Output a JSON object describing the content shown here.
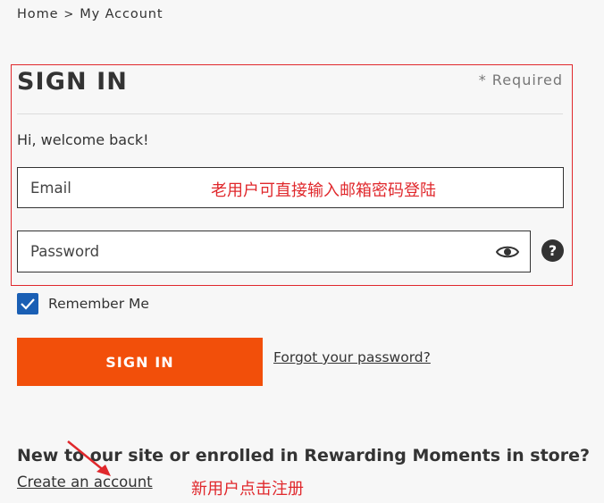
{
  "breadcrumb": {
    "home": "Home",
    "separator": ">",
    "current": "My Account"
  },
  "signin": {
    "title": "SIGN IN",
    "required_note": "* Required",
    "welcome": "Hi, welcome back!",
    "email_placeholder": "Email",
    "password_placeholder": "Password",
    "help_symbol": "?",
    "remember_label": "Remember Me",
    "remember_checked": true,
    "button_label": "SIGN IN",
    "forgot_link": "Forgot your password?"
  },
  "register": {
    "heading": "New to our site or enrolled in Rewarding Moments in store?",
    "create_link": "Create an account"
  },
  "annotations": {
    "login_note": "老用户可直接输入邮箱密码登陆",
    "register_note": "新用户点击注册",
    "color": "#e0282c"
  },
  "colors": {
    "accent": "#f24f0a",
    "checkbox": "#1a5fb4",
    "text": "#333333"
  },
  "icons": {
    "password_toggle": "eye-icon",
    "help": "help-icon",
    "checkbox": "check-icon"
  }
}
